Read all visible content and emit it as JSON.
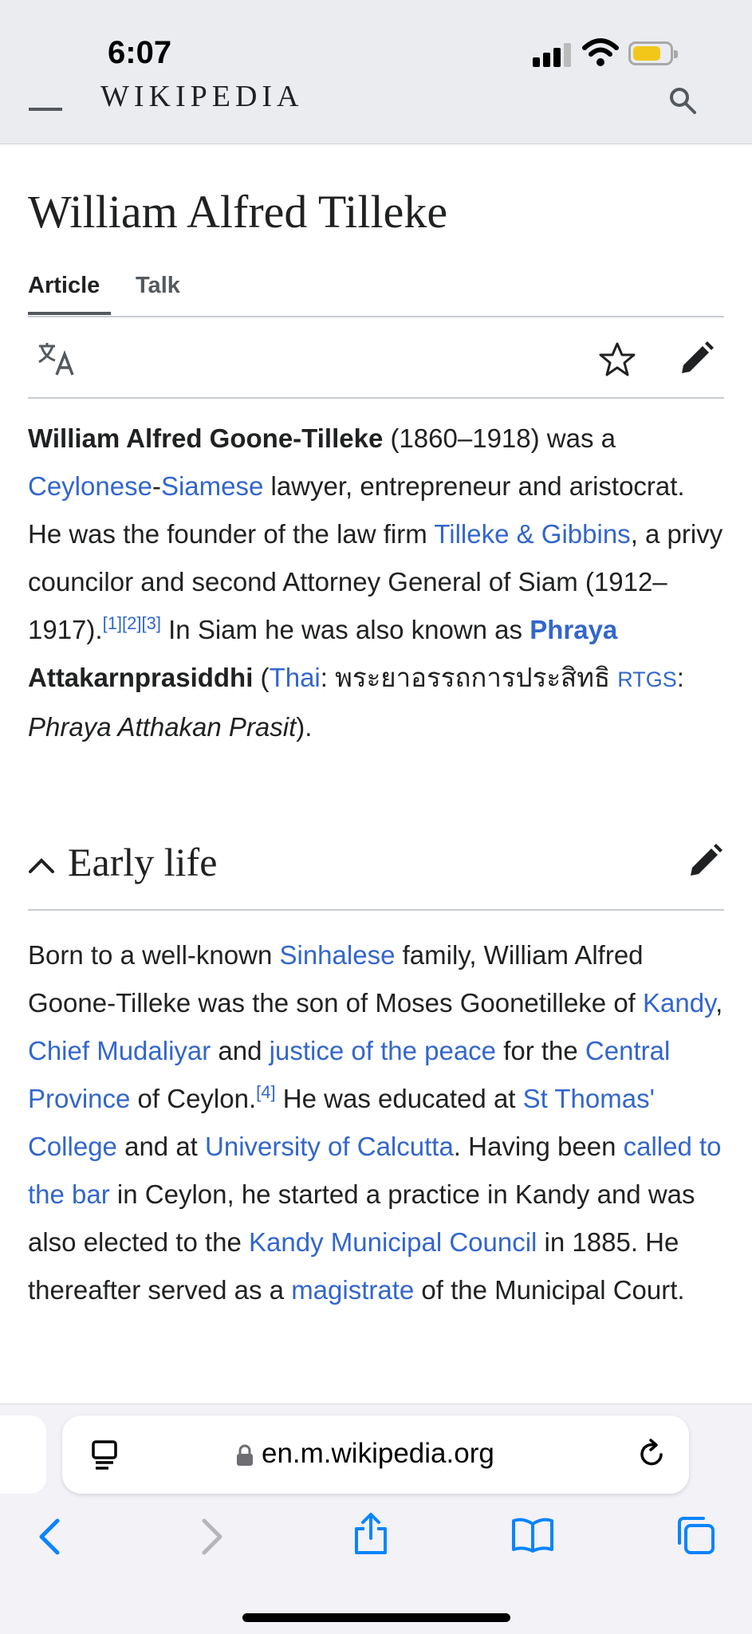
{
  "status_bar": {
    "time": "6:07"
  },
  "header": {
    "wordmark": "WIKIPEDIA"
  },
  "article": {
    "title": "William Alfred Tilleke",
    "tabs": [
      {
        "label": "Article",
        "active": true
      },
      {
        "label": "Talk",
        "active": false
      }
    ],
    "intro": {
      "bold_name": "William Alfred Goone-Tilleke",
      "t1": " (1860–1918) was a ",
      "l_ceylonese": "Ceylonese",
      "dash": "-",
      "l_siamese": "Siamese",
      "t2": " lawyer, entrepreneur and aristocrat. He was the founder of the law firm ",
      "l_tilleke": "Tilleke & Gibbins",
      "t3": ", a privy councilor and second Attorney General of Siam (1912–1917).",
      "refs": "[1][2][3]",
      "t4": " In Siam he was also known as ",
      "b_phraya": "Phraya",
      "b_atta": "Attakarnprasiddhi",
      "t5": " (",
      "l_thai": "Thai",
      "t6": ": พระยาอรรถการประสิทธิ ",
      "l_rtgs": "RTGS",
      "t7": ": ",
      "i_phraya": "Phraya Atthakan Prasit",
      "t8": ")."
    },
    "section": {
      "title": "Early life",
      "s1": "Born to a well-known ",
      "l_sinhalese": "Sinhalese",
      "s2": " family, William Alfred Goone-Tilleke was the son of Moses Goonetilleke of ",
      "l_kandy": "Kandy",
      "s3": ", ",
      "l_mudaliyar": "Chief Mudaliyar",
      "s4": " and ",
      "l_justice": "justice of the peace",
      "s5": " for the ",
      "l_central": "Central Province",
      "s6": " of Ceylon.",
      "ref4": "[4]",
      "s7": " He was educated at ",
      "l_stthomas": "St Thomas' College",
      "s8": " and at ",
      "l_calcutta": "University of Calcutta",
      "s9": ". Having been ",
      "l_bar": "called to the bar",
      "s10": " in Ceylon, he started a practice in Kandy and was also elected to the ",
      "l_council": "Kandy Municipal Council",
      "s11": " in 1885. He thereafter served as a ",
      "l_magistrate": "magistrate",
      "s12": " of the Municipal Court."
    }
  },
  "browser": {
    "url": "en.m.wikipedia.org"
  },
  "colors": {
    "link": "#3366cc",
    "text": "#202122",
    "header_bg": "#eaecf0",
    "battery": "#f2c71a",
    "ios_blue": "#0a84ff"
  }
}
